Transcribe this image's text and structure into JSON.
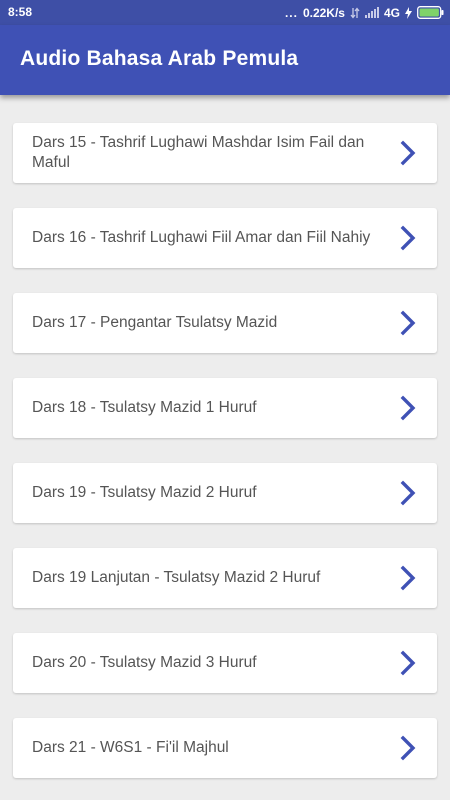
{
  "status_bar": {
    "time": "8:58",
    "dots": "...",
    "speed": "0.22K/s",
    "network": "4G"
  },
  "app_bar": {
    "title": "Audio Bahasa Arab Pemula"
  },
  "colors": {
    "primary": "#3f51b5",
    "status_bar": "#3e4fa6",
    "chevron": "#3f51b5",
    "background": "#ededed"
  },
  "list": {
    "items": [
      {
        "label": "Dars 15 - Tashrif Lughawi Mashdar Isim Fail dan Maful",
        "icon": "chevron-right-icon"
      },
      {
        "label": "Dars 16 - Tashrif Lughawi Fiil Amar dan Fiil Nahiy",
        "icon": "chevron-right-icon"
      },
      {
        "label": "Dars 17 - Pengantar Tsulatsy Mazid",
        "icon": "chevron-right-icon"
      },
      {
        "label": "Dars 18 - Tsulatsy Mazid 1 Huruf",
        "icon": "chevron-right-icon"
      },
      {
        "label": "Dars 19 - Tsulatsy Mazid 2 Huruf",
        "icon": "chevron-right-icon"
      },
      {
        "label": "Dars 19 Lanjutan - Tsulatsy Mazid 2 Huruf",
        "icon": "chevron-right-icon"
      },
      {
        "label": "Dars 20 - Tsulatsy Mazid 3 Huruf",
        "icon": "chevron-right-icon"
      },
      {
        "label": "Dars 21 - W6S1 - Fi'il Majhul",
        "icon": "chevron-right-icon"
      }
    ]
  }
}
